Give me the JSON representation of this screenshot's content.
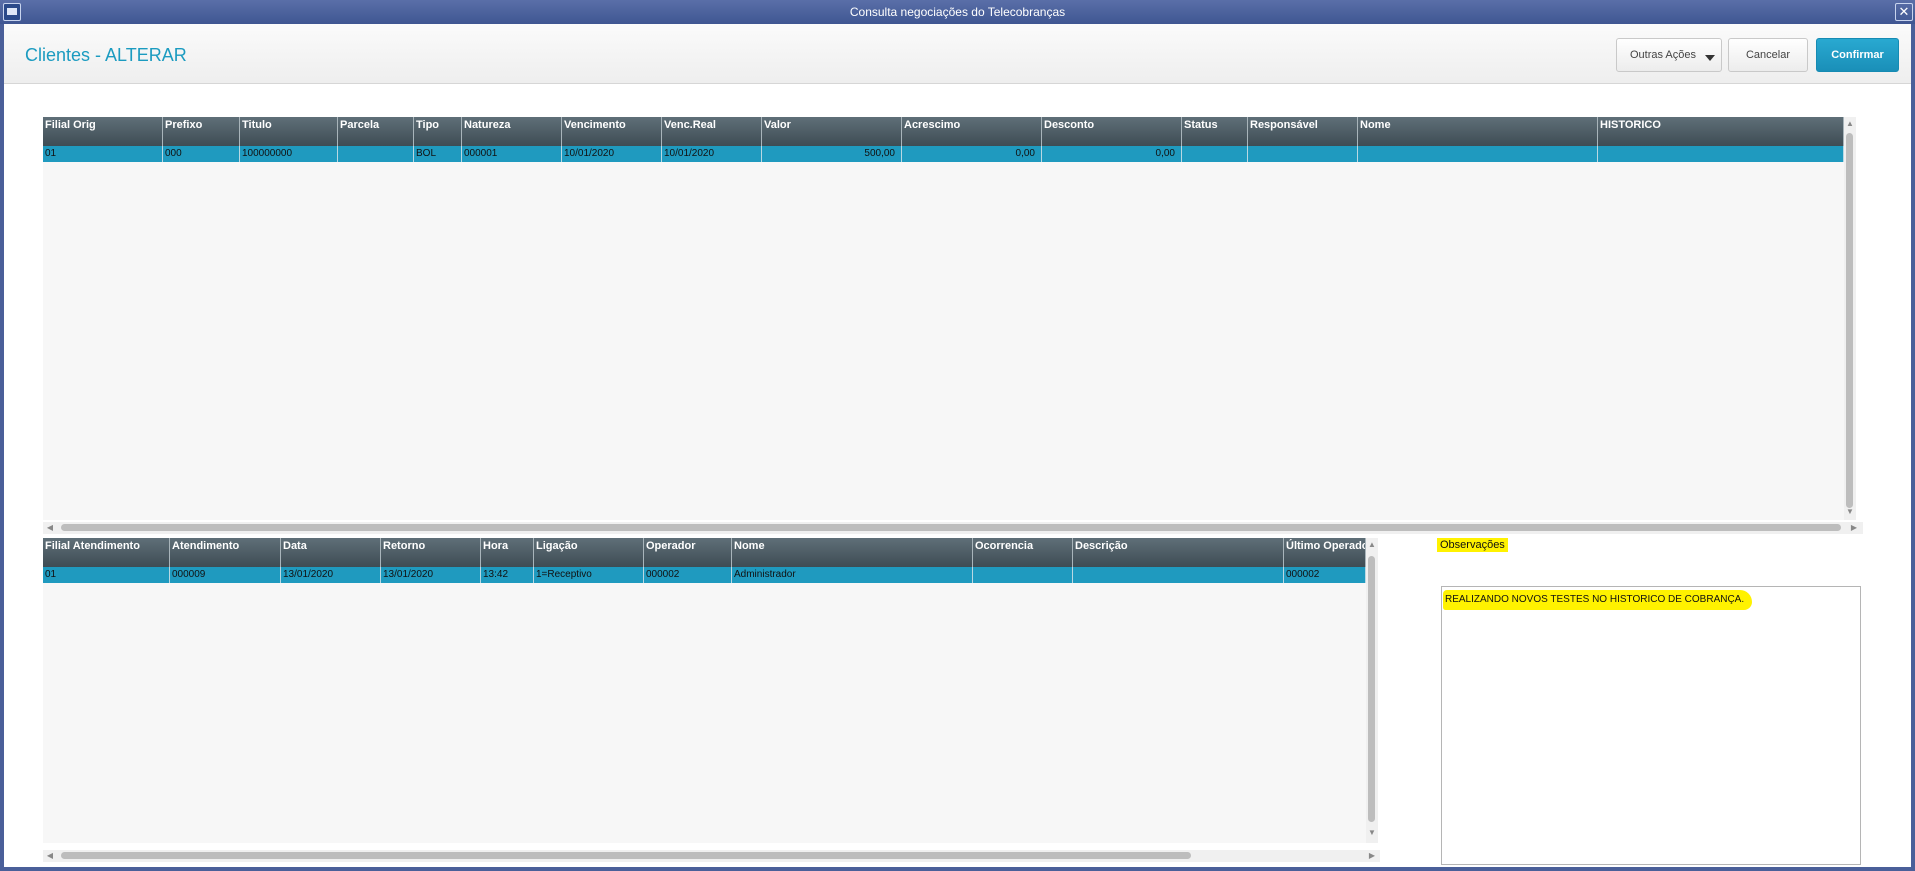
{
  "window": {
    "title": "Consulta negociações do Telecobranças",
    "close": "✕"
  },
  "header": {
    "page_title": "Clientes - ALTERAR",
    "outras_acoes": "Outras Ações",
    "cancelar": "Cancelar",
    "confirmar": "Confirmar"
  },
  "titles_grid": {
    "columns": [
      "Filial Orig",
      "Prefixo",
      "Titulo",
      "Parcela",
      "Tipo",
      "Natureza",
      "Vencimento",
      "Venc.Real",
      "Valor",
      "Acrescimo",
      "Desconto",
      "Status",
      "Responsável",
      "Nome",
      "HISTORICO"
    ],
    "rows": [
      [
        "01",
        "000",
        "100000000",
        "",
        "BOL",
        "000001",
        "10/01/2020",
        "10/01/2020",
        "500,00",
        "0,00",
        "0,00",
        "",
        "",
        "",
        ""
      ]
    ]
  },
  "service_grid": {
    "columns": [
      "Filial Atendimento",
      "Atendimento",
      "Data",
      "Retorno",
      "Hora",
      "Ligação",
      "Operador",
      "Nome",
      "Ocorrencia",
      "Descrição",
      "Último Operador"
    ],
    "rows": [
      [
        "01",
        "000009",
        "13/01/2020",
        "13/01/2020",
        "13:42",
        "1=Receptivo",
        "000002",
        "Administrador",
        "",
        "",
        "000002"
      ]
    ]
  },
  "observacoes": {
    "label": "Observações",
    "text": "REALIZANDO NOVOS TESTES NO HISTORICO DE COBRANÇA."
  },
  "colors": {
    "accent": "#1f9abf",
    "confirm": "#1a8fb8",
    "highlight": "#fff200",
    "window_frame": "#4a5f99"
  }
}
